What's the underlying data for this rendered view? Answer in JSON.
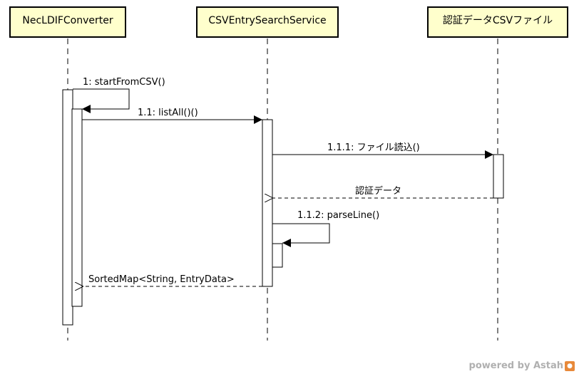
{
  "lifelines": [
    {
      "id": "nec",
      "label": "NecLDIFConverter"
    },
    {
      "id": "csv",
      "label": "CSVEntrySearchService"
    },
    {
      "id": "file",
      "label": "認証データCSVファイル"
    }
  ],
  "messages": [
    {
      "id": "m1",
      "label": "1: startFromCSV()",
      "kind": "self"
    },
    {
      "id": "m2",
      "label": "1.1: listAll()()",
      "kind": "call"
    },
    {
      "id": "m3",
      "label": "1.1.1: ファイル読込()",
      "kind": "call"
    },
    {
      "id": "m4",
      "label": "認証データ",
      "kind": "return"
    },
    {
      "id": "m5",
      "label": "1.1.2: parseLine()",
      "kind": "self"
    },
    {
      "id": "m6",
      "label": "SortedMap<String, EntryData>",
      "kind": "return"
    }
  ],
  "watermark": {
    "text": "powered by Astah",
    "logo": "astah-logo-icon"
  }
}
